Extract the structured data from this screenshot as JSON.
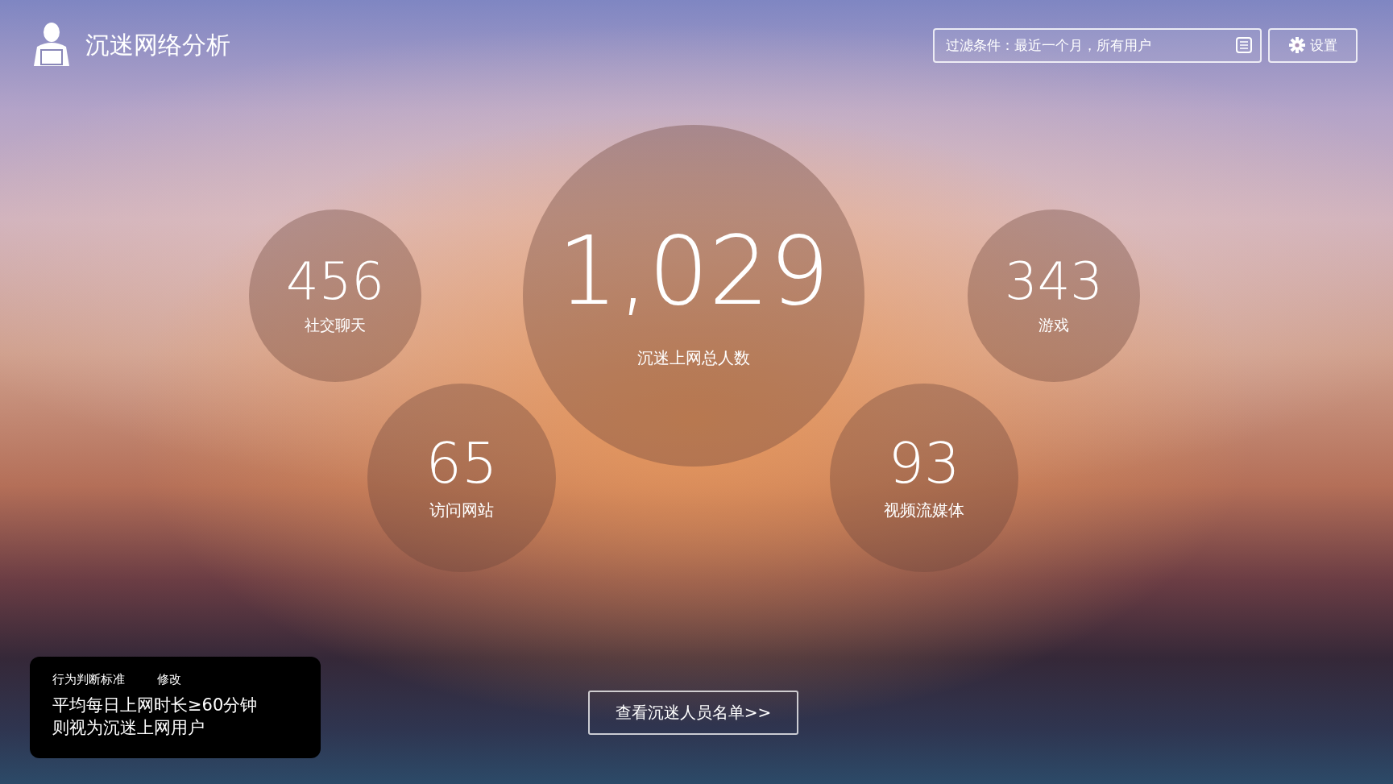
{
  "header": {
    "title": "沉迷网络分析"
  },
  "filter": {
    "value": "过滤条件：最近一个月，所有用户"
  },
  "settings_button": {
    "label": "设置"
  },
  "total": {
    "value": "1,029",
    "label": "沉迷上网总人数"
  },
  "categories": [
    {
      "value": "456",
      "label": "社交聊天"
    },
    {
      "value": "343",
      "label": "游戏"
    },
    {
      "value": "65",
      "label": "访问网站"
    },
    {
      "value": "93",
      "label": "视频流媒体"
    }
  ],
  "criteria": {
    "title": "行为判断标准",
    "edit_link": "修改",
    "rule_lines": [
      "平均每日上网时长≥60分钟",
      "则视为沉迷上网用户"
    ]
  },
  "list_button": {
    "label": "查看沉迷人员名单>>"
  }
}
